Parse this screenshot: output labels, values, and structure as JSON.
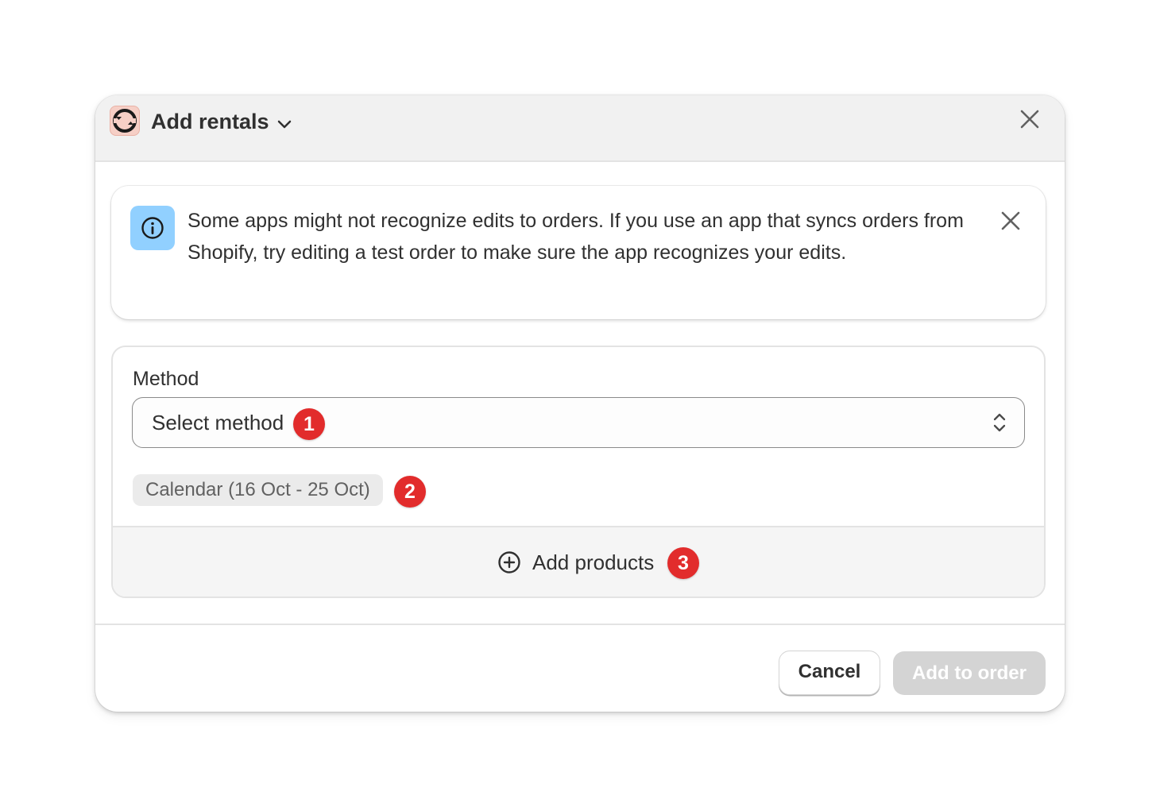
{
  "header": {
    "title": "Add rentals",
    "app_icon": "sync-arrows-icon",
    "close_icon": "close-icon"
  },
  "banner": {
    "icon": "info-icon",
    "text": "Some apps might not recognize edits to orders. If you use an app that syncs orders from Shopify, try editing a test order to make sure the app recognizes your edits.",
    "dismiss_icon": "close-icon"
  },
  "method": {
    "label": "Method",
    "selected_value": "Select method",
    "step_badge": "1"
  },
  "calendar_tag": {
    "text": "Calendar (16 Oct - 25 Oct)",
    "step_badge": "2"
  },
  "add_products": {
    "label": "Add products",
    "icon": "plus-circle-icon",
    "step_badge": "3"
  },
  "footer": {
    "cancel_label": "Cancel",
    "primary_label": "Add to order",
    "primary_disabled": true
  },
  "colors": {
    "badge": "#e22c2c",
    "info_icon_bg": "#91d0ff",
    "app_icon_bg": "#f6cfc6",
    "disabled_button": "#d4d4d4"
  }
}
